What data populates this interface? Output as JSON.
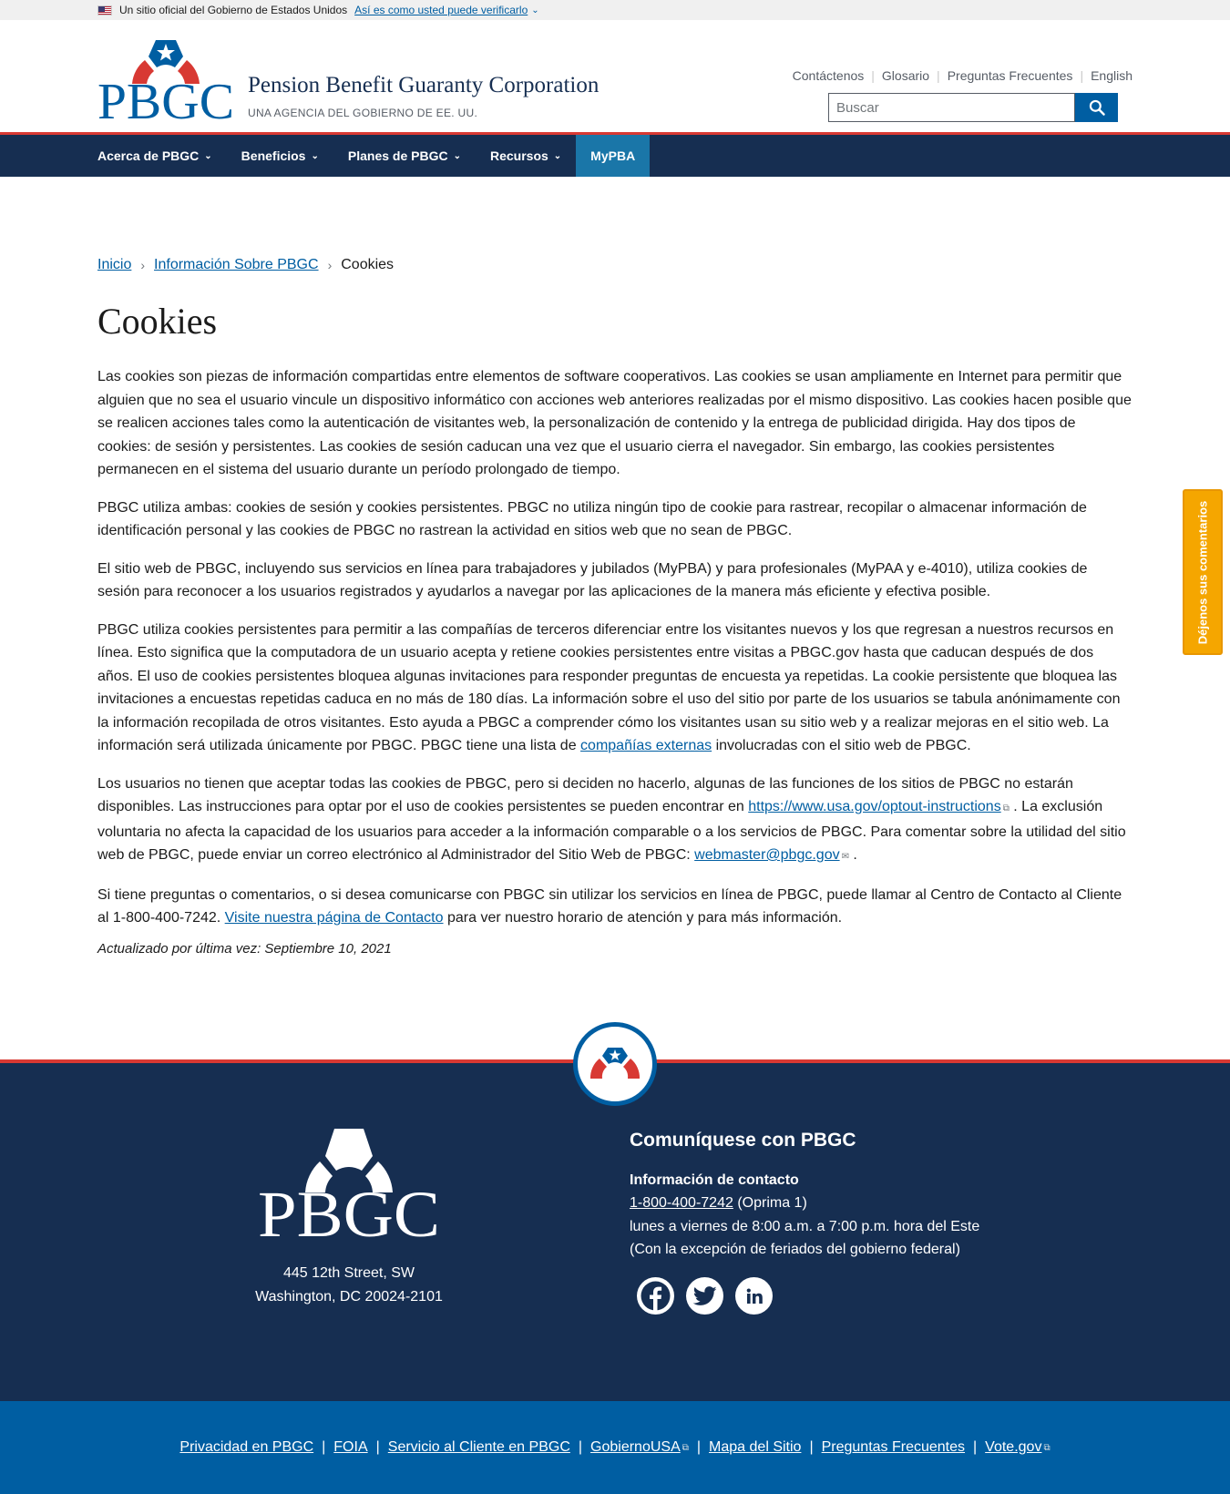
{
  "gov_banner": {
    "text": "Un sitio oficial del Gobierno de Estados Unidos",
    "verify_link": "Así es como usted puede verificarlo"
  },
  "header": {
    "logo_text": "PBGC",
    "site_name": "Pension Benefit Guaranty Corporation",
    "site_sub": "UNA AGENCIA DEL GOBIERNO DE EE. UU.",
    "util_links": [
      "Contáctenos",
      "Glosario",
      "Preguntas Frecuentes",
      "English"
    ],
    "search_placeholder": "Buscar"
  },
  "nav": {
    "items": [
      "Acerca de PBGC",
      "Beneficios",
      "Planes de PBGC",
      "Recursos"
    ],
    "mypba": "MyPBA"
  },
  "breadcrumb": {
    "home": "Inicio",
    "parent": "Información Sobre PBGC",
    "current": "Cookies"
  },
  "page": {
    "title": "Cookies",
    "p1": "Las cookies son piezas de información compartidas entre elementos de software cooperativos. Las cookies se usan ampliamente en Internet para permitir que alguien que no sea el usuario vincule un dispositivo informático con acciones web anteriores realizadas por el mismo dispositivo. Las cookies hacen posible que se realicen acciones tales como la autenticación de visitantes web, la personalización de contenido y la entrega de publicidad dirigida. Hay dos tipos de cookies: de sesión y persistentes. Las cookies de sesión caducan una vez que el usuario cierra el navegador. Sin embargo, las cookies persistentes permanecen en el sistema del usuario durante un período prolongado de tiempo.",
    "p2": "PBGC utiliza ambas: cookies de sesión y cookies persistentes. PBGC no utiliza ningún tipo de cookie para rastrear, recopilar o almacenar información de identificación personal y las cookies de PBGC no rastrean la actividad en sitios web que no sean de PBGC.",
    "p3": "El sitio web de PBGC, incluyendo sus servicios en línea para trabajadores y jubilados (MyPBA) y para profesionales (MyPAA y e-4010), utiliza cookies de sesión para reconocer a los usuarios registrados y ayudarlos a navegar por las aplicaciones de la manera más eficiente y efectiva posible.",
    "p4_a": "PBGC utiliza cookies persistentes para permitir a las compañías de terceros diferenciar entre los visitantes nuevos y los que regresan a nuestros recursos en línea. Esto significa que la computadora de un usuario acepta y retiene cookies persistentes entre visitas a PBGC.gov hasta que caducan después de dos años. El uso de cookies persistentes bloquea algunas invitaciones para responder preguntas de encuesta ya repetidas. La cookie persistente que bloquea las invitaciones a encuestas repetidas caduca en no más de 180 días. La información sobre el uso del sitio por parte de los usuarios se tabula anónimamente con la información recopilada de otros visitantes. Esto ayuda a PBGC a comprender cómo los visitantes usan su sitio web y a realizar mejoras en el sitio web. La información será utilizada únicamente por PBGC. PBGC tiene una lista de ",
    "p4_link": "compañías externas",
    "p4_b": " involucradas con el sitio web de PBGC.",
    "p5_a": "Los usuarios no tienen que aceptar todas las cookies de PBGC, pero si deciden no hacerlo, algunas de las funciones de los sitios de PBGC no estarán disponibles. Las instrucciones para optar por el uso de cookies persistentes se pueden encontrar en ",
    "p5_link": "https://www.usa.gov/optout-instructions",
    "p5_b": " . La exclusión voluntaria no afecta la capacidad de los usuarios para acceder a la información comparable o a los servicios de PBGC. Para comentar sobre la utilidad del sitio web de PBGC, puede enviar un correo electrónico al Administrador del Sitio Web de PBGC: ",
    "p5_email": "webmaster@pbgc.gov",
    "p5_c": " .",
    "p6_a": "Si tiene preguntas o comentarios, o si desea comunicarse con PBGC sin utilizar los servicios en línea de PBGC, puede llamar al Centro de Contacto al Cliente al 1-800-400-7242. ",
    "p6_link": "Visite nuestra página de Contacto",
    "p6_b": " para ver nuestro horario de atención y para más información.",
    "updated": "Actualizado por última vez: Septiembre 10, 2021"
  },
  "feedback": "Déjenos sus comentarios",
  "footer": {
    "logo_text": "PBGC",
    "address_1": "445 12th Street, SW",
    "address_2": "Washington, DC 20024-2101",
    "contact_title": "Comuníquese con PBGC",
    "contact_label": "Información de contacto",
    "phone": "1-800-400-7242",
    "phone_note": " (Oprima 1)",
    "hours": "lunes a viernes de 8:00 a.m. a 7:00 p.m. hora del Este",
    "holidays": "(Con la excepción de feriados del gobierno federal)",
    "links": [
      "Privacidad en PBGC",
      "FOIA",
      "Servicio al Cliente en PBGC",
      "GobiernoUSA",
      "Mapa del Sitio",
      "Preguntas Frecuentes",
      "Vote.gov"
    ]
  },
  "colors": {
    "navy": "#162e51",
    "blue": "#005ea2",
    "red": "#d83933",
    "feedback": "#f5a600"
  }
}
